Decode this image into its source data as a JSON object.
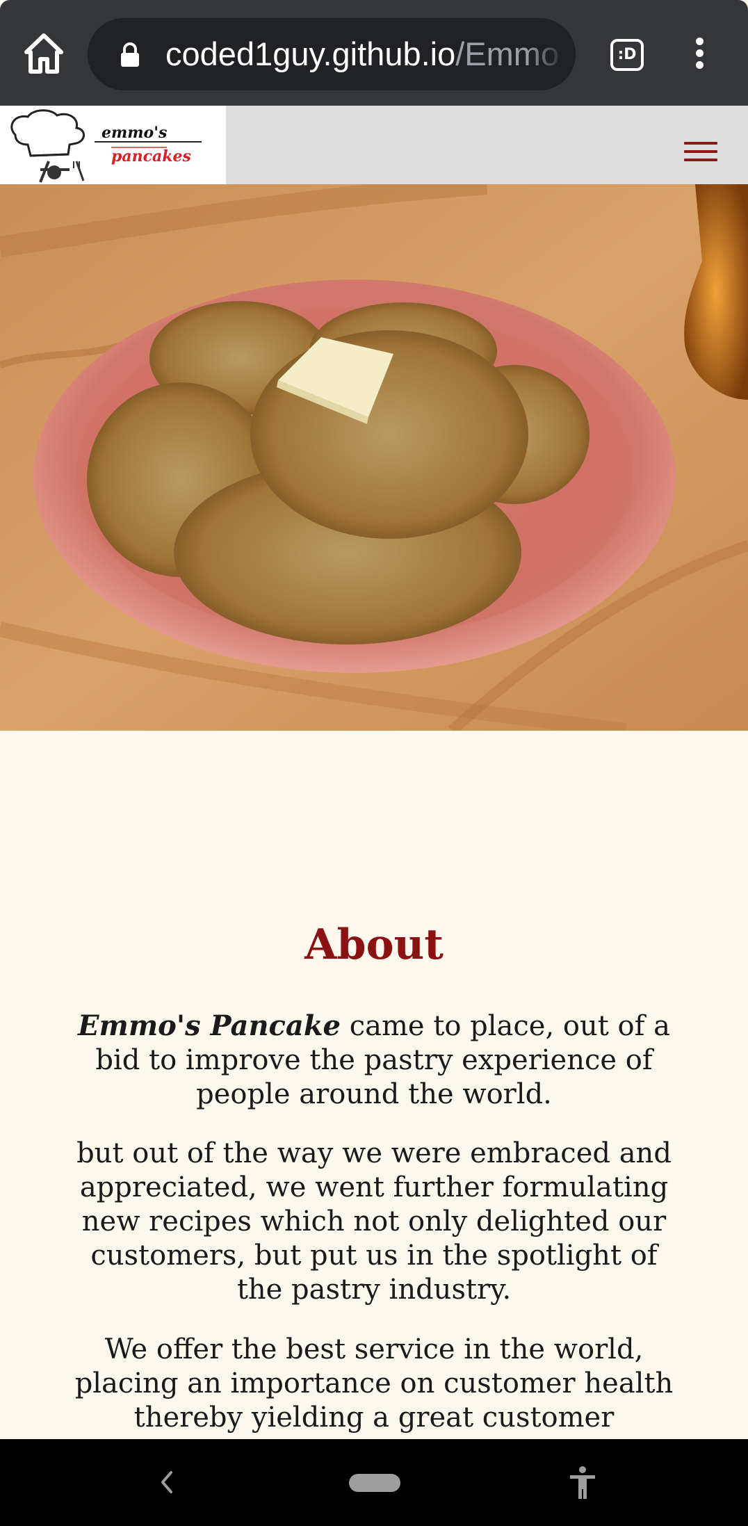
{
  "browser": {
    "url_host": "coded1guy.github.io",
    "url_path": "/Emmo",
    "tabs_badge": ":D",
    "icons": [
      "home-icon",
      "lock-icon",
      "tab-switcher-icon",
      "more-vert-icon"
    ]
  },
  "site": {
    "logo_text_line1": "emmo's",
    "logo_text_line2": "pancakes",
    "menu_icon": "hamburger-icon",
    "accent_color": "#8b1212"
  },
  "about": {
    "title": "About",
    "p1_brand": "Emmo's Pancake",
    "p1_rest": " came to place, out of a bid to improve the pastry experience of people around the world.",
    "p2": "but out of the way we were embraced and appreciated, we went further formulating new recipes which not only delighted our customers, but put us in the spotlight of the pastry industry.",
    "p3": "We offer the best service in the world, placing an importance on customer health thereby yielding a great customer"
  },
  "system_nav": {
    "icons": [
      "back-icon",
      "home-pill-icon",
      "accessibility-icon"
    ]
  }
}
